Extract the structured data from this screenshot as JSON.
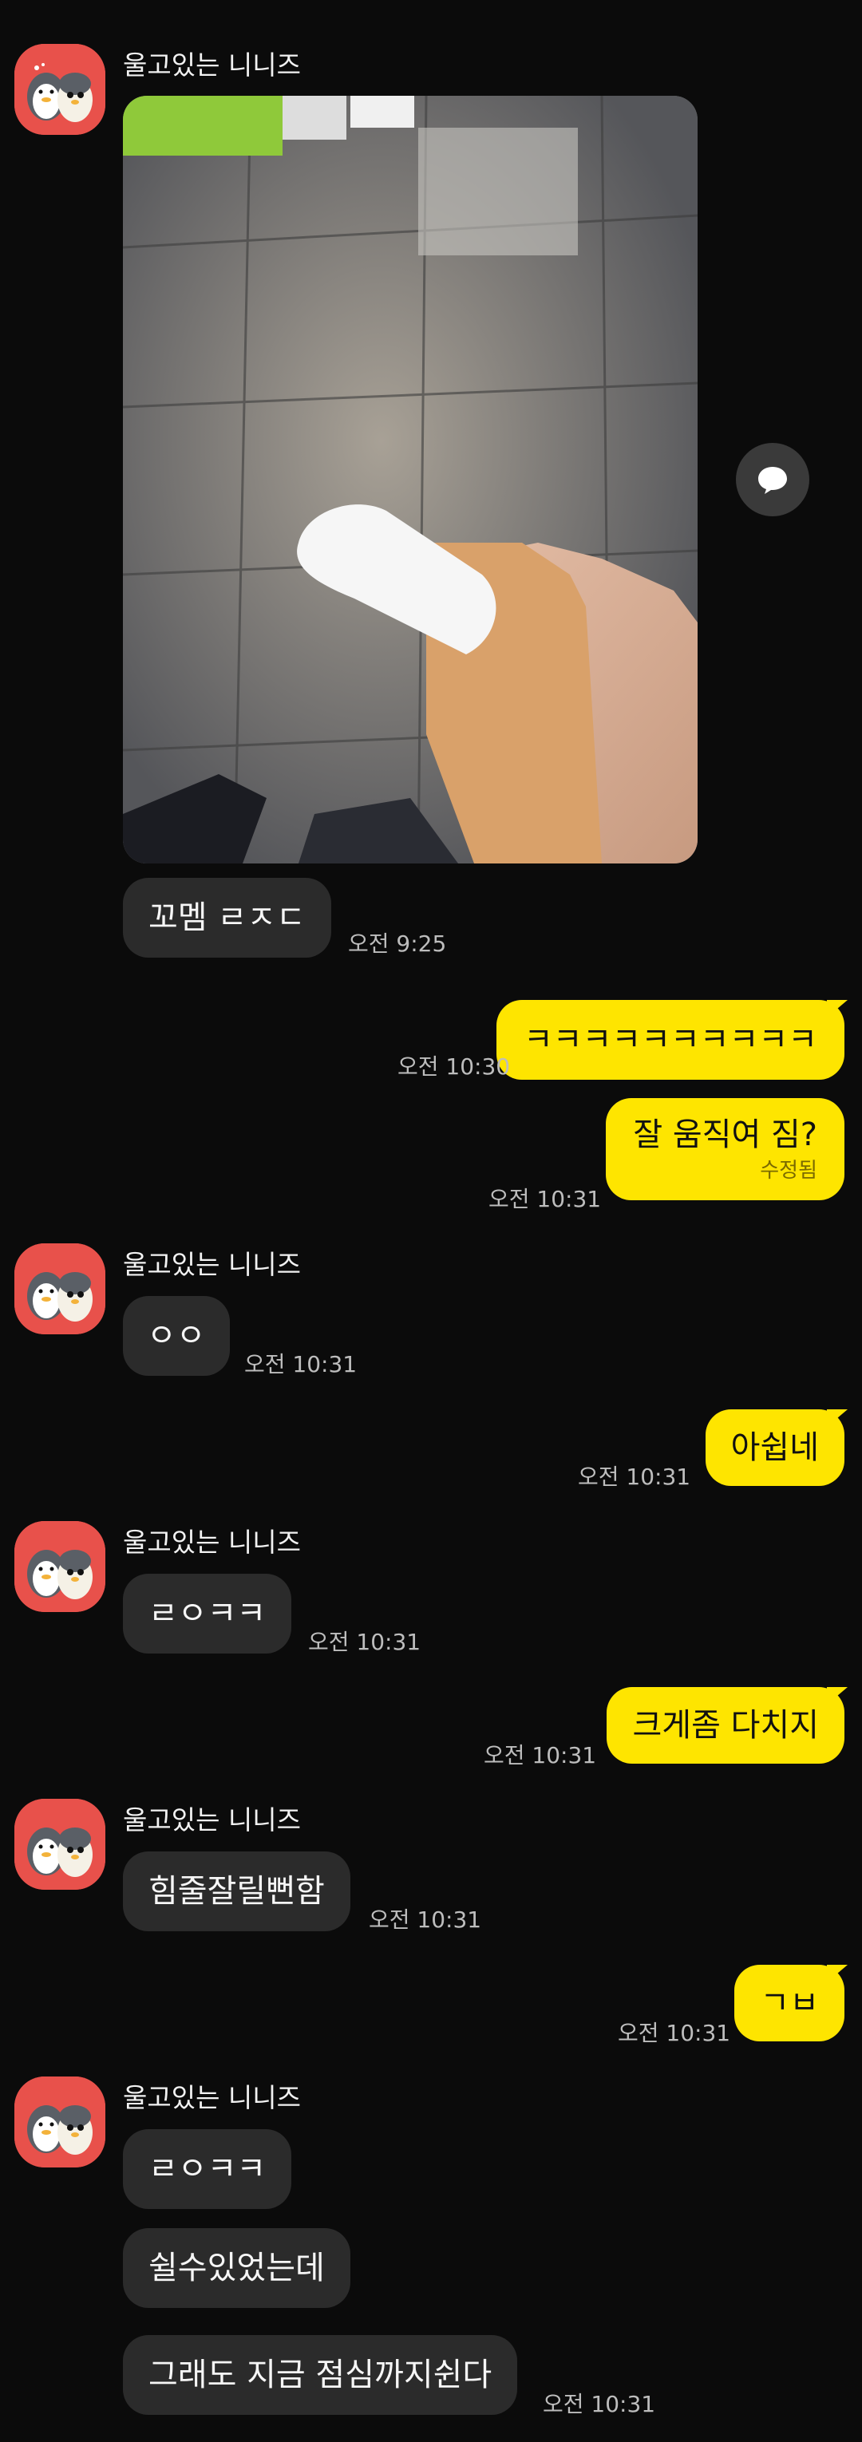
{
  "sender": {
    "name": "울고있는 니니즈"
  },
  "colors": {
    "background": "#0b0b0b",
    "incoming_bubble": "#2b2b2b",
    "outgoing_bubble": "#fee500",
    "avatar_bg": "#e8514b"
  },
  "icons": {
    "share": "speech-bubble-icon",
    "avatar": "penguin-characters-avatar"
  },
  "messages": {
    "m1_photo_time": "",
    "m1_text": "꼬멤 ㄹㅈㄷ",
    "m1_time": "오전 9:25",
    "m2_text": "ㅋㅋㅋㅋㅋㅋㅋㅋㅋㅋ",
    "m2_time": "오전 10:30",
    "m3_text": "잘 움직여 짐?",
    "m3_edited": "수정됨",
    "m3_time": "오전 10:31",
    "m4_text": "ㅇㅇ",
    "m4_time": "오전 10:31",
    "m5_text": "아쉽네",
    "m5_time": "오전 10:31",
    "m6_text": "ㄹㅇㅋㅋ",
    "m6_time": "오전 10:31",
    "m7_text": "크게좀 다치지",
    "m7_time": "오전 10:31",
    "m8_text": "힘줄잘릴뻔함",
    "m8_time": "오전 10:31",
    "m9_text": "ㄱㅂ",
    "m9_time": "오전 10:31",
    "m10_text": "ㄹㅇㅋㅋ",
    "m11_text": "쉴수있었는데",
    "m12_text": "그래도 지금 점심까지쉰다",
    "m12_time": "오전 10:31"
  }
}
